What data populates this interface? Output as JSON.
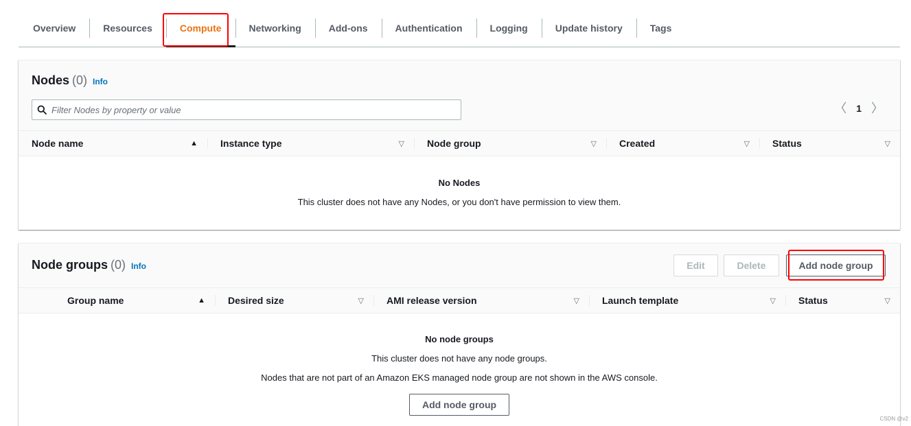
{
  "tabs": [
    {
      "label": "Overview"
    },
    {
      "label": "Resources"
    },
    {
      "label": "Compute",
      "active": true
    },
    {
      "label": "Networking"
    },
    {
      "label": "Add-ons"
    },
    {
      "label": "Authentication"
    },
    {
      "label": "Logging"
    },
    {
      "label": "Update history"
    },
    {
      "label": "Tags"
    }
  ],
  "nodes": {
    "title": "Nodes",
    "count": "(0)",
    "info": "Info",
    "search_placeholder": "Filter Nodes by property or value",
    "pager": {
      "prev": "〈",
      "page": "1",
      "next": "〉"
    },
    "columns": [
      "Node name",
      "Instance type",
      "Node group",
      "Created",
      "Status"
    ],
    "empty_title": "No Nodes",
    "empty_text": "This cluster does not have any Nodes, or you don't have permission to view them."
  },
  "node_groups": {
    "title": "Node groups",
    "count": "(0)",
    "info": "Info",
    "edit_label": "Edit",
    "delete_label": "Delete",
    "add_label": "Add node group",
    "columns": [
      "Group name",
      "Desired size",
      "AMI release version",
      "Launch template",
      "Status"
    ],
    "empty_title": "No node groups",
    "empty_text_1": "This cluster does not have any node groups.",
    "empty_text_2": "Nodes that are not part of an Amazon EKS managed node group are not shown in the AWS console.",
    "empty_button": "Add node group"
  },
  "colors": {
    "active_tab": "#ec7211",
    "link": "#0073bb",
    "highlight": "#ff0000"
  },
  "watermark": "CSDN @v2"
}
